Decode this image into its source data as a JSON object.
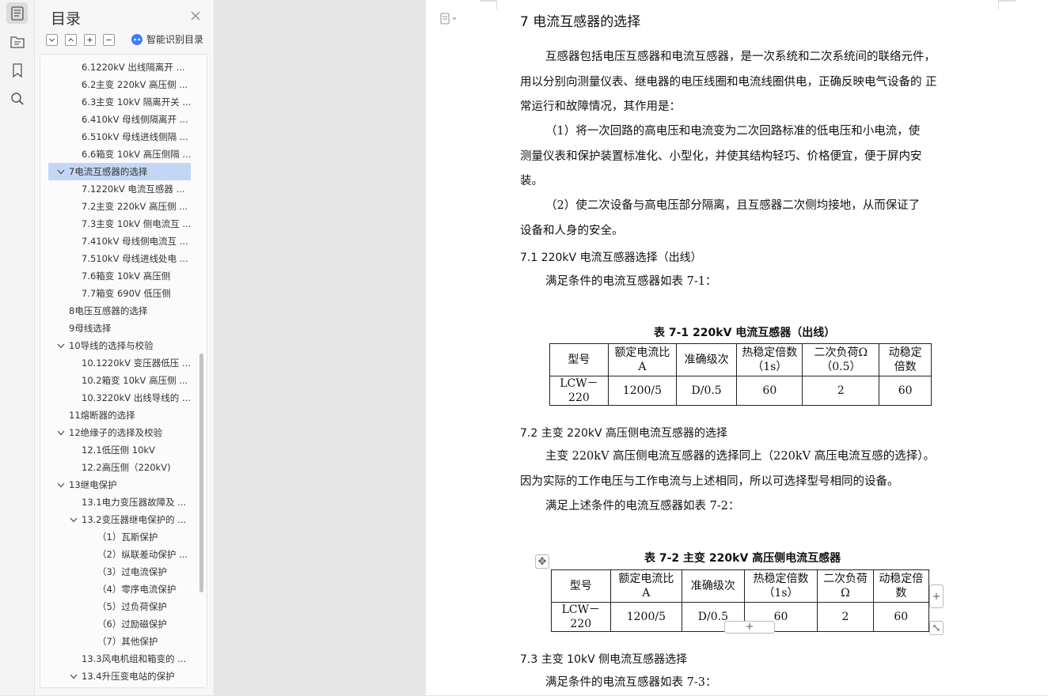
{
  "sidebar": {
    "title": "目录",
    "smart_label": "智能识别目录",
    "toc": [
      {
        "label": "6.1220kV 出线隔离开 ...",
        "level": 2
      },
      {
        "label": "6.2主变 220kV 高压侧 ...",
        "level": 2
      },
      {
        "label": "6.3主变 10kV 隔离开关 ...",
        "level": 2
      },
      {
        "label": "6.410kV 母线侧隔离开 ...",
        "level": 2
      },
      {
        "label": "6.510kV 母线进线侧隔 ...",
        "level": 2
      },
      {
        "label": "6.6箱变 10kV 高压侧隔 ...",
        "level": 2
      },
      {
        "label": "7电流互感器的选择",
        "level": 1,
        "expanded": true,
        "selected": true
      },
      {
        "label": "7.1220kV 电流互感器 ...",
        "level": 2
      },
      {
        "label": "7.2主变 220kV 高压侧 ...",
        "level": 2
      },
      {
        "label": "7.3主变 10kV 侧电流互 ...",
        "level": 2
      },
      {
        "label": "7.410kV 母线侧电流互 ...",
        "level": 2
      },
      {
        "label": "7.510kV 母线进线处电 ...",
        "level": 2
      },
      {
        "label": "7.6箱变 10kV 高压侧",
        "level": 2
      },
      {
        "label": "7.7箱变 690V 低压侧",
        "level": 2
      },
      {
        "label": "8电压互感器的选择",
        "level": 1
      },
      {
        "label": "9母线选择",
        "level": 1
      },
      {
        "label": "10导线的选择与校验",
        "level": 1,
        "expanded": true
      },
      {
        "label": "10.1220kV 变压器低压 ...",
        "level": 2
      },
      {
        "label": "10.2箱变 10kV 高压侧 ...",
        "level": 2
      },
      {
        "label": "10.3220kV 出线导线的 ...",
        "level": 2
      },
      {
        "label": "11熔断器的选择",
        "level": 1
      },
      {
        "label": "12绝缘子的选择及校验",
        "level": 1,
        "expanded": true
      },
      {
        "label": "12.1低压侧 10kV",
        "level": 2
      },
      {
        "label": "12.2高压侧（220kV)",
        "level": 2
      },
      {
        "label": "13继电保护",
        "level": 1,
        "expanded": true
      },
      {
        "label": "13.1电力变压器故障及 ...",
        "level": 2
      },
      {
        "label": "13.2变压器继电保护的 ...",
        "level": 2,
        "expanded": true
      },
      {
        "label": "（1）瓦斯保护",
        "level": 3
      },
      {
        "label": "（2）纵联差动保护 ...",
        "level": 3
      },
      {
        "label": "（3）过电流保护",
        "level": 3
      },
      {
        "label": "（4）零序电流保护",
        "level": 3
      },
      {
        "label": "（5）过负荷保护",
        "level": 3
      },
      {
        "label": "（6）过励磁保护",
        "level": 3
      },
      {
        "label": "（7）其他保护",
        "level": 3
      },
      {
        "label": "13.3风电机组和箱变的 ...",
        "level": 2
      },
      {
        "label": "13.4升压变电站的保护",
        "level": 2,
        "expanded": true
      }
    ]
  },
  "document": {
    "heading": "7  电流互感器的选择",
    "intro_lines": [
      "互感器包括电压互感器和电流互感器，是一次系统和二次系统间的联络元件，",
      "用以分别向测量仪表、继电器的电压线圈和电流线圈供电，正确反映电气设备的 正",
      "常运行和故障情况，其作用是："
    ],
    "item1_lines": [
      "（1）将一次回路的高电压和电流变为二次回路标准的低电压和小电流，使",
      "测量仪表和保护装置标准化、小型化，并使其结构轻巧、价格便宜，便于屏内安",
      "装。"
    ],
    "item2_lines": [
      "（2）使二次设备与高电压部分隔离，且互感器二次侧均接地，从而保证了",
      "设备和人身的安全。"
    ],
    "s71_title": "7.1  220kV  电流互感器选择（出线）",
    "s71_text": "满足条件的电流互感器如表  7-1：",
    "t1_caption": "表  7-1  220kV  电流互感器（出线）",
    "t1_headers": [
      "型号",
      "额定电流比 A",
      "准确级次",
      "热稳定倍数（1s）",
      "二次负荷Ω（0.5）",
      "动稳定倍数"
    ],
    "t1_row": [
      "LCW－220",
      "1200/5",
      "D/0.5",
      "60",
      "2",
      "60"
    ],
    "s72_title": "7.2  主变 220kV 高压侧电流互感器的选择",
    "s72_lines": [
      "主变  220kV 高压侧电流互感器的选择同上（220kV 高压电流互感的选择）。",
      "因为实际的工作电压与工作电流与上述相同，所以可选择型号相同的设备。",
      "满足上述条件的电流互感器如表  7-2："
    ],
    "t2_caption": "表  7-2  主变  220kV  高压侧电流互感器",
    "t2_headers": [
      "型号",
      "额定电流比 A",
      "准确级次",
      "热稳定倍数（1s）",
      "二次负荷Ω",
      "动稳定倍数"
    ],
    "t2_row": [
      "LCW－220",
      "1200/5",
      "D/0.5",
      "60",
      "2",
      "60"
    ],
    "s73_title": "7.3  主变 10kV 侧电流互感器选择",
    "s73_text": "满足条件的电流互感器如表  7-3："
  },
  "icons": [
    "outline-icon",
    "folder-tree-icon",
    "bookmark-icon",
    "search-icon"
  ]
}
